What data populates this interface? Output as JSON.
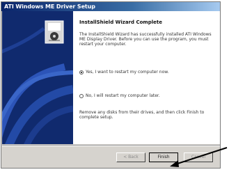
{
  "window": {
    "title": "ATI Windows ME Driver Setup"
  },
  "content": {
    "heading": "InstallShield Wizard Complete",
    "paragraph": "The InstallShield Wizard has successfully installed ATI Windows ME Display Driver. Before you can use the program, you must restart your computer.",
    "options": [
      {
        "label": "Yes, I want to restart my computer now.",
        "selected": true
      },
      {
        "label": "No, I will restart my computer later.",
        "selected": false
      }
    ],
    "note": "Remove any disks from their drives, and then click Finish to complete setup."
  },
  "buttons": {
    "back": "< Back",
    "finish": "Finish",
    "cancel": "Cancel"
  }
}
